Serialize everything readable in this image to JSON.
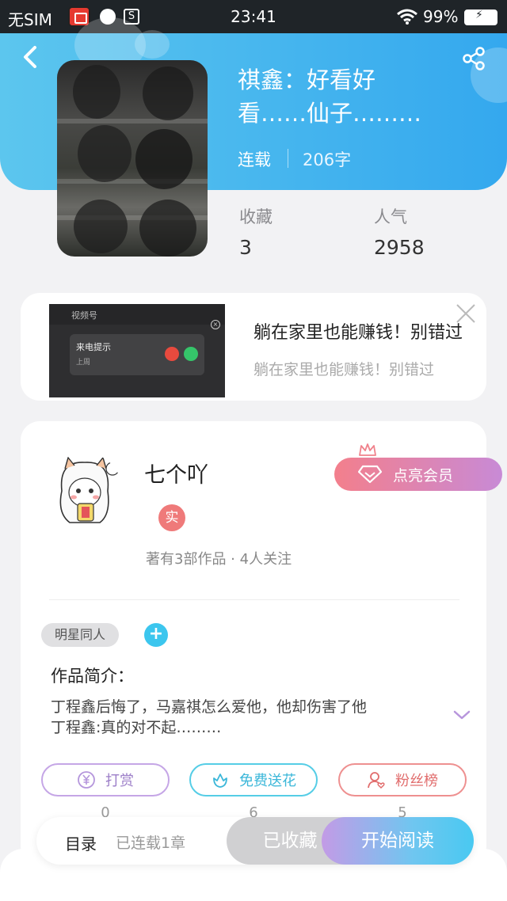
{
  "status_bar": {
    "carrier": "无SIM",
    "app3_glyph": "S",
    "time": "23:41",
    "battery": "99%"
  },
  "book": {
    "title_line1": "祺鑫：好看好",
    "title_line2": "看……仙子………",
    "status": "连载",
    "words": "206字",
    "stats": [
      {
        "label": "收藏",
        "value": "3"
      },
      {
        "label": "人气",
        "value": "2958"
      }
    ]
  },
  "ad": {
    "thumb_app": "视频号",
    "popup_title": "来电提示",
    "popup_sub": "上周",
    "title": "躺在家里也能赚钱！别错过",
    "subtitle": "躺在家里也能赚钱！别错过"
  },
  "author": {
    "name": "七个吖",
    "badge": "实",
    "meta": "著有3部作品 · 4人关注",
    "vip_label": "点亮会员"
  },
  "tags": {
    "items": [
      "明星同人"
    ],
    "add": "+"
  },
  "intro": {
    "heading": "作品简介：",
    "line1": "丁程鑫后悔了，马嘉祺怎么爱他，他却伤害了他",
    "line2": "丁程鑫:真的对不起………"
  },
  "actions": [
    {
      "label": "打赏",
      "count": "0",
      "icon": "yen-coin-icon"
    },
    {
      "label": "免费送花",
      "count": "6",
      "icon": "flower-icon"
    },
    {
      "label": "粉丝榜",
      "count": "5",
      "icon": "fans-icon"
    }
  ],
  "bottom_bar": {
    "catalog": "目录",
    "chapters": "已连载1章",
    "collected": "已收藏",
    "read": "开始阅读"
  },
  "colors": {
    "header_start": "#5cc6ee",
    "header_end": "#34a8ee",
    "vip_start": "#f37f8c",
    "vip_end": "#c88ad6",
    "read_start": "#c39be6",
    "read_end": "#49c9f1"
  }
}
